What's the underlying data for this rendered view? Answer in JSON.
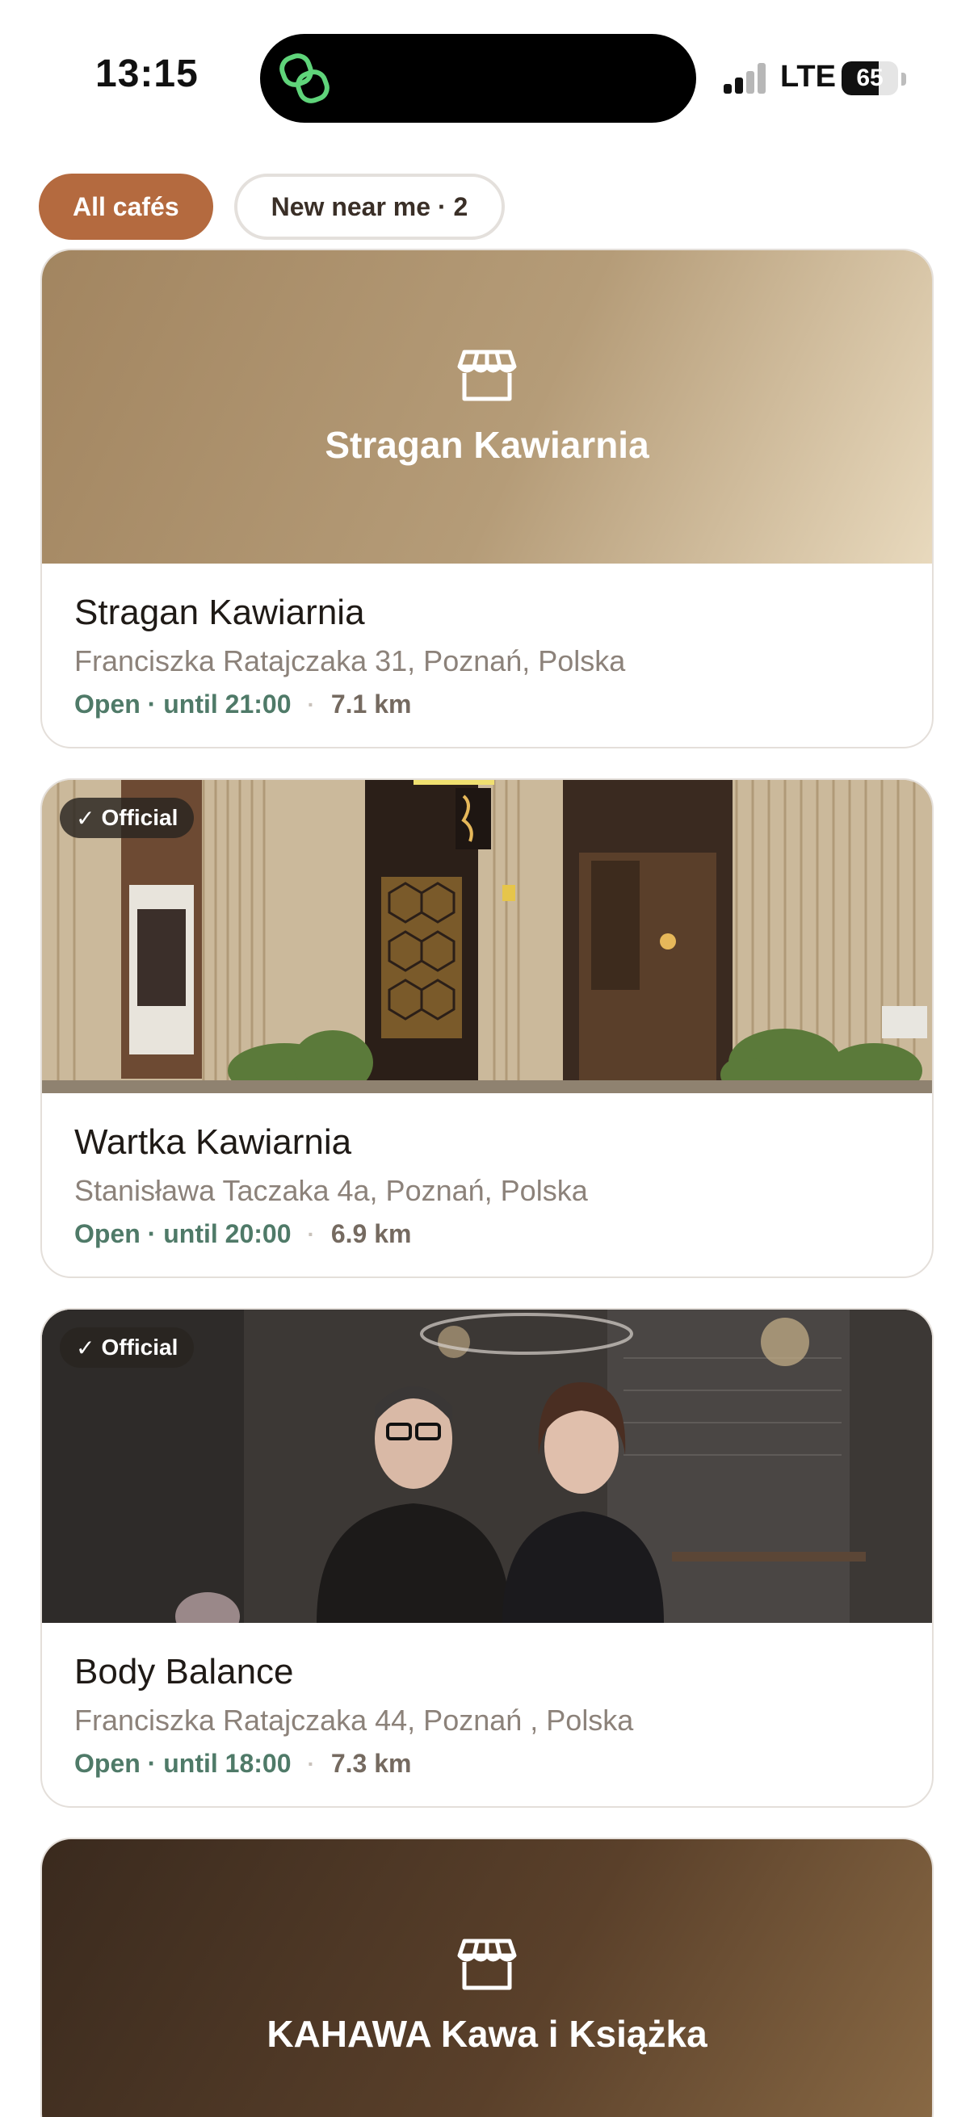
{
  "status_bar": {
    "time": "13:15",
    "network": "LTE",
    "battery": "65",
    "battery_level_percent": 65,
    "app_icon": "linked-rings-icon",
    "app_icon_color": "#5fd47a"
  },
  "filters": {
    "all_label": "All cafés",
    "new_label": "New near me · 2",
    "active_color": "#b46a3f"
  },
  "cafes": [
    {
      "image_title": "Stragan Kawiarnia",
      "name": "Stragan Kawiarnia",
      "address": "Franciszka Ratajczaka 31, Poznań, Polska",
      "open": "Open · until 21:00",
      "separator": "·",
      "distance": "7.1 km",
      "icon": "storefront-icon"
    },
    {
      "badge": "Official",
      "name": "Wartka Kawiarnia",
      "address": "Stanisława Taczaka 4a, Poznań, Polska",
      "open": "Open · until 20:00",
      "separator": "·",
      "distance": "6.9 km"
    },
    {
      "badge": "Official",
      "name": "Body Balance",
      "address": "Franciszka Ratajczaka 44, Poznań , Polska",
      "open": "Open · until 18:00",
      "separator": "·",
      "distance": "7.3 km"
    },
    {
      "image_title": "KAHAWA Kawa i Książka",
      "icon": "storefront-icon"
    }
  ],
  "colors": {
    "open_status": "#4f7a68",
    "address_text": "#8c827a"
  }
}
